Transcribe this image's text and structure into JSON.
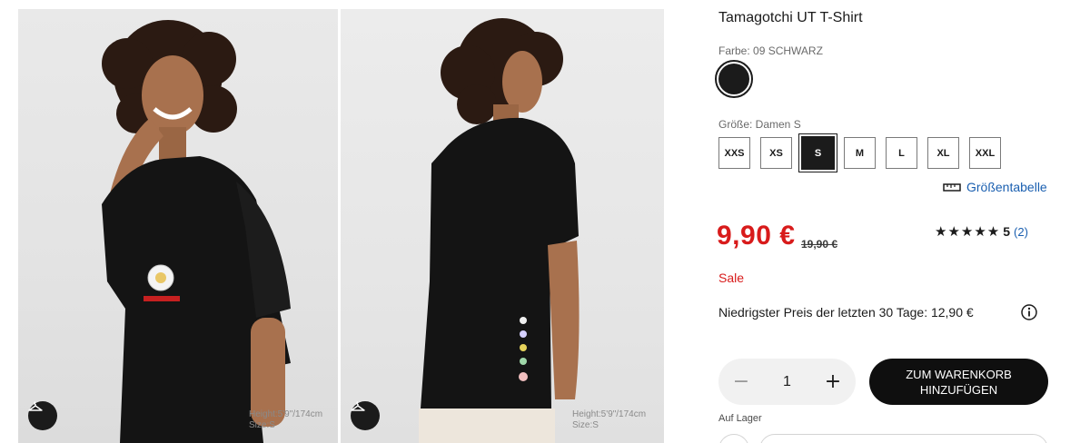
{
  "gallery": {
    "images": [
      {
        "model_info_line1": "Height:5'9\"/174cm",
        "model_info_line2": "Size:S",
        "icon": "hanger-icon"
      },
      {
        "model_info_line1": "Height:5'9\"/174cm",
        "model_info_line2": "Size:S",
        "icon": "hanger-icon"
      }
    ]
  },
  "product": {
    "title": "Tamagotchi UT T-Shirt",
    "color_label": "Farbe: 09 SCHWARZ",
    "color_hex": "#1b1b1b",
    "size_label": "Größe: Damen S",
    "sizes": [
      "XXS",
      "XS",
      "S",
      "M",
      "L",
      "XL",
      "XXL"
    ],
    "selected_size": "S",
    "size_chart_label": "Größentabelle",
    "size_chart_icon": "ruler-icon",
    "price": "9,90 €",
    "old_price": "19,90 €",
    "rating_stars": "★★★★★",
    "rating_score": "5",
    "rating_count": "(2)",
    "sale_label": "Sale",
    "lowest_price_text": "Niedrigster Preis der letzten 30 Tage: 12,90 €",
    "info_icon": "info-icon",
    "quantity": "1",
    "minus_symbol": "−",
    "plus_symbol": "+",
    "add_to_cart_label": "ZUM WARENKORB HINZUFÜGEN",
    "stock_label": "Auf Lager"
  },
  "colors": {
    "price_red": "#d81b1b",
    "link_blue": "#1a5fb0",
    "primary_black": "#0f0f0f"
  }
}
